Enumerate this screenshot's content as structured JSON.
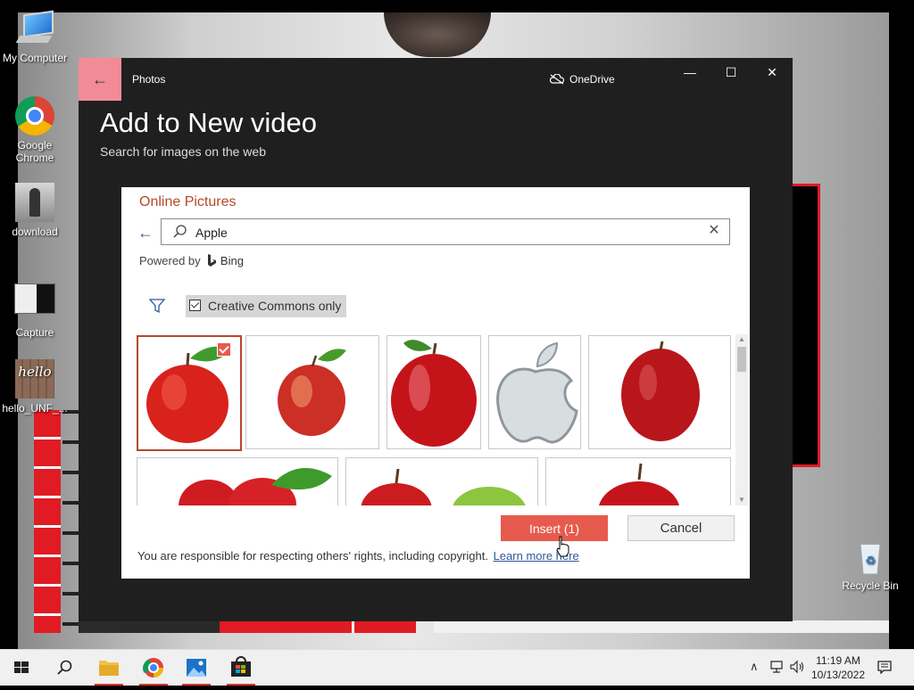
{
  "desktop": {
    "icons": [
      {
        "label": "My Computer"
      },
      {
        "label": "Google Chrome"
      },
      {
        "label": "download"
      },
      {
        "label": "Capture"
      },
      {
        "label": "hello_UNF_..."
      },
      {
        "label": "Recycle Bin"
      }
    ],
    "hello_thumb_text": "hello"
  },
  "photos": {
    "app_title": "Photos",
    "onedrive_label": "OneDrive",
    "heading": "Add to New video",
    "subheading": "Search for images on the web",
    "controls": {
      "minimize": "—",
      "maximize": "☐",
      "close": "✕"
    }
  },
  "dialog": {
    "title": "Online Pictures",
    "search": {
      "value": "Apple",
      "placeholder": ""
    },
    "powered_by": "Powered by",
    "bing": "Bing",
    "filter": {
      "label": "Creative Commons only",
      "checked": true
    },
    "results": [
      {
        "name": "apple-1",
        "selected": true
      },
      {
        "name": "apple-2",
        "selected": false
      },
      {
        "name": "apple-3",
        "selected": false
      },
      {
        "name": "apple-logo",
        "selected": false
      },
      {
        "name": "apple-5",
        "selected": false
      },
      {
        "name": "apples-6",
        "selected": false
      },
      {
        "name": "apples-7",
        "selected": false
      },
      {
        "name": "apple-8",
        "selected": false
      }
    ],
    "insert_label": "Insert (1)",
    "cancel_label": "Cancel",
    "rights_text": "You are responsible for respecting others' rights, including copyright.",
    "learn_more": "Learn more here"
  },
  "taskbar": {
    "time": "11:19 AM",
    "date": "10/13/2022",
    "items": [
      "start",
      "search",
      "file-explorer",
      "chrome",
      "photos",
      "store"
    ]
  },
  "colors": {
    "accent": "#e65b4e",
    "dialog_title": "#b7472a",
    "back_button": "#f28b96"
  }
}
